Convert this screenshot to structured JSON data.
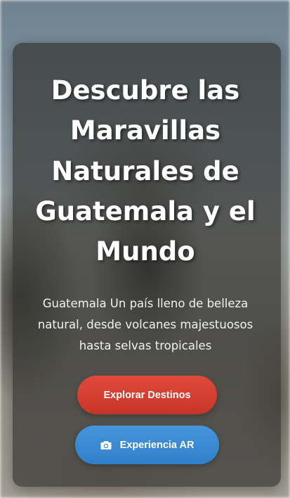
{
  "hero": {
    "title": "Descubre las Maravillas Naturales de Guatemala y el Mundo",
    "subtitle": "Guatemala Un país lleno de belleza natural, desde volcanes majestuosos hasta selvas tropicales"
  },
  "buttons": {
    "explore_label": "Explorar Destinos",
    "ar_label": "Experiencia AR",
    "ar_icon": "camera-icon"
  },
  "colors": {
    "explore_button": "#d63e31",
    "ar_button": "#3a8ad4",
    "card_overlay": "#30302e"
  }
}
